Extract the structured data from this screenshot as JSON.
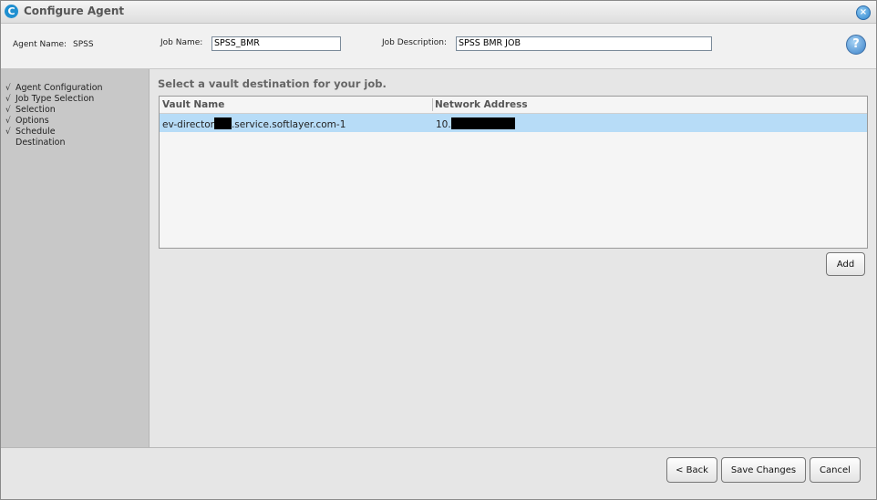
{
  "window": {
    "title": "Configure Agent",
    "close_icon": "×",
    "app_icon": "C"
  },
  "header": {
    "agent_name_label": "Agent Name:",
    "agent_name": "SPSS",
    "job_name_label": "Job Name:",
    "job_name_value": "SPSS_BMR",
    "job_description_label": "Job Description:",
    "job_description_value": "SPSS BMR JOB",
    "help_icon": "?"
  },
  "sidebar": {
    "check_glyph": "√",
    "items": [
      {
        "label": "Agent Configuration"
      },
      {
        "label": "Job Type Selection"
      },
      {
        "label": "Selection"
      },
      {
        "label": "Options"
      },
      {
        "label": "Schedule"
      },
      {
        "label": "Destination"
      }
    ]
  },
  "main": {
    "heading": "Select a vault destination for your job.",
    "table": {
      "columns": [
        "Vault Name",
        "Network Address"
      ],
      "rows": [
        {
          "vault_prefix": "ev-director",
          "vault_suffix": ".service.softlayer.com-1",
          "address_prefix": "10."
        }
      ]
    },
    "add_button": "Add"
  },
  "footer": {
    "back_button": "< Back",
    "save_button": "Save Changes",
    "cancel_button": "Cancel"
  },
  "colors": {
    "selected_row": "#b7dcf7",
    "sidebar_bg": "#c8c8c8",
    "accent": "#1f8fd0"
  }
}
